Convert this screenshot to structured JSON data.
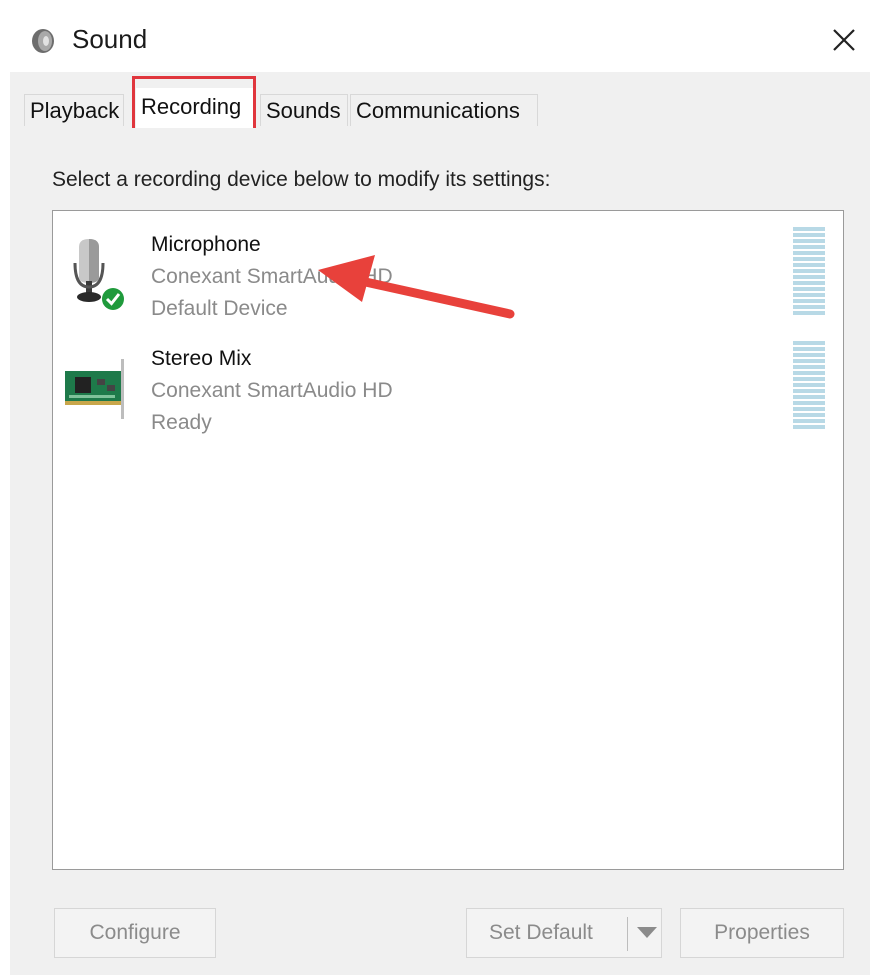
{
  "window": {
    "title": "Sound"
  },
  "tabs": [
    {
      "label": "Playback"
    },
    {
      "label": "Recording"
    },
    {
      "label": "Sounds"
    },
    {
      "label": "Communications"
    }
  ],
  "active_tab": "Recording",
  "instruction": "Select a recording device below to modify its settings:",
  "devices": [
    {
      "name": "Microphone",
      "driver": "Conexant SmartAudio HD",
      "status": "Default Device",
      "icon": "microphone-icon",
      "is_default": true
    },
    {
      "name": "Stereo Mix",
      "driver": "Conexant SmartAudio HD",
      "status": "Ready",
      "icon": "sound-card-icon",
      "is_default": false
    }
  ],
  "buttons": {
    "configure": "Configure",
    "set_default": "Set Default",
    "properties": "Properties"
  },
  "colors": {
    "highlight": "#e0363d",
    "default_check": "#1f9a3c",
    "level_meter": "#b8d9e6"
  }
}
